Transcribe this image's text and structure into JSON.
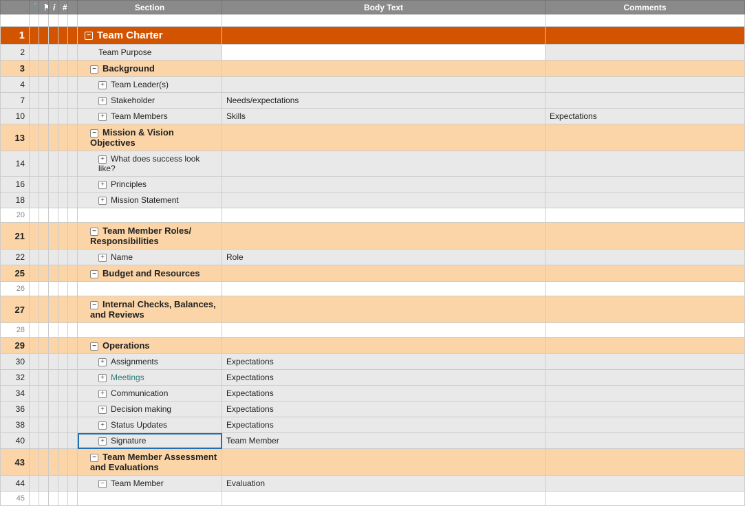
{
  "headers": {
    "section": "Section",
    "body": "Body Text",
    "comments": "Comments",
    "attach_icon_title": "paperclip",
    "flag_icon_title": "flag",
    "info_icon_title": "info",
    "num_icon_title": "#"
  },
  "rows": [
    {
      "num": "1",
      "level": 0,
      "icon": "minus-w",
      "section": "Team Charter",
      "body": "",
      "comments": ""
    },
    {
      "num": "2",
      "level": 2,
      "icon": "",
      "section": "Team Purpose",
      "body": "",
      "comments": "",
      "blankBody": true
    },
    {
      "num": "3",
      "level": 1,
      "icon": "minus",
      "section": "Background",
      "body": "",
      "comments": ""
    },
    {
      "num": "4",
      "level": 2,
      "icon": "plus",
      "section": "Team Leader(s)",
      "body": "",
      "comments": ""
    },
    {
      "num": "7",
      "level": 2,
      "icon": "plus",
      "section": "Stakeholder",
      "body": "Needs/expectations",
      "comments": ""
    },
    {
      "num": "10",
      "level": 2,
      "icon": "plus",
      "section": "Team Members",
      "body": "Skills",
      "comments": "Expectations"
    },
    {
      "num": "13",
      "level": 1,
      "icon": "minus",
      "section": "Mission & Vision Objectives",
      "body": "",
      "comments": ""
    },
    {
      "num": "14",
      "level": 2,
      "icon": "plus",
      "section": "What does success look like?",
      "body": "",
      "comments": ""
    },
    {
      "num": "16",
      "level": 2,
      "icon": "plus",
      "section": "Principles",
      "body": "",
      "comments": ""
    },
    {
      "num": "18",
      "level": 2,
      "icon": "plus",
      "section": "Mission Statement",
      "body": "",
      "comments": ""
    },
    {
      "num": "20",
      "level": -1,
      "icon": "",
      "section": "",
      "body": "",
      "comments": ""
    },
    {
      "num": "21",
      "level": 1,
      "icon": "minus",
      "section": "Team Member Roles/ Responsibilities",
      "body": "",
      "comments": "",
      "tall": true
    },
    {
      "num": "22",
      "level": 2,
      "icon": "plus",
      "section": "Name",
      "body": "Role",
      "comments": ""
    },
    {
      "num": "25",
      "level": 1,
      "icon": "minus",
      "section": "Budget and Resources",
      "body": "",
      "comments": ""
    },
    {
      "num": "26",
      "level": -1,
      "icon": "",
      "section": "",
      "body": "",
      "comments": ""
    },
    {
      "num": "27",
      "level": 1,
      "icon": "minus",
      "section": "Internal Checks, Balances, and Reviews",
      "body": "",
      "comments": "",
      "tall": true
    },
    {
      "num": "28",
      "level": -1,
      "icon": "",
      "section": "",
      "body": "",
      "comments": ""
    },
    {
      "num": "29",
      "level": 1,
      "icon": "minus",
      "section": "Operations",
      "body": "",
      "comments": ""
    },
    {
      "num": "30",
      "level": 2,
      "icon": "plus",
      "section": "Assignments",
      "body": "Expectations",
      "comments": ""
    },
    {
      "num": "32",
      "level": 2,
      "icon": "plus",
      "section": "Meetings",
      "body": "Expectations",
      "comments": "",
      "teal": true
    },
    {
      "num": "34",
      "level": 2,
      "icon": "plus",
      "section": "Communication",
      "body": "Expectations",
      "comments": ""
    },
    {
      "num": "36",
      "level": 2,
      "icon": "plus",
      "section": "Decision making",
      "body": "Expectations",
      "comments": ""
    },
    {
      "num": "38",
      "level": 2,
      "icon": "plus",
      "section": "Status Updates",
      "body": "Expectations",
      "comments": ""
    },
    {
      "num": "40",
      "level": 2,
      "icon": "plus",
      "section": "Signature",
      "body": "Team Member",
      "comments": "",
      "selected": true
    },
    {
      "num": "43",
      "level": 1,
      "icon": "minus",
      "section": "Team Member Assessment and Evaluations",
      "body": "",
      "comments": "",
      "tall": true
    },
    {
      "num": "44",
      "level": 2,
      "icon": "minus",
      "section": "Team Member",
      "body": "Evaluation",
      "comments": ""
    },
    {
      "num": "45",
      "level": -1,
      "icon": "",
      "section": "",
      "body": "",
      "comments": ""
    }
  ],
  "icons": {
    "paperclip": "📎",
    "flag": "⚑",
    "info": "i",
    "hash": "#"
  }
}
